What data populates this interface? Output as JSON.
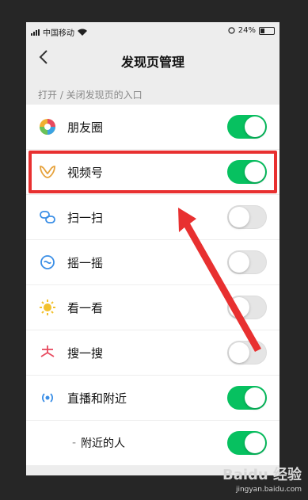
{
  "status_bar": {
    "carrier": "中国移动",
    "battery": "24%"
  },
  "header": {
    "back_icon": "chevron-left-icon",
    "title": "发现页管理"
  },
  "section_hint": "打开 / 关闭发现页的入口",
  "items": [
    {
      "label": "朋友圈",
      "icon": "moments-icon",
      "enabled": true
    },
    {
      "label": "视频号",
      "icon": "channels-icon",
      "enabled": true
    },
    {
      "label": "扫一扫",
      "icon": "scan-icon",
      "enabled": false
    },
    {
      "label": "摇一摇",
      "icon": "shake-icon",
      "enabled": false
    },
    {
      "label": "看一看",
      "icon": "top-stories-icon",
      "enabled": false
    },
    {
      "label": "搜一搜",
      "icon": "search-icon",
      "enabled": false
    },
    {
      "label": "直播和附近",
      "icon": "live-icon",
      "enabled": true
    },
    {
      "label": "附近的人",
      "icon": "",
      "enabled": true,
      "sub": true
    }
  ],
  "sub_prefix": "-",
  "watermark": {
    "logo": "Baidu 经验",
    "url": "jingyan.baidu.com"
  },
  "colors": {
    "toggle_on": "#07c160",
    "highlight": "#e83030"
  }
}
